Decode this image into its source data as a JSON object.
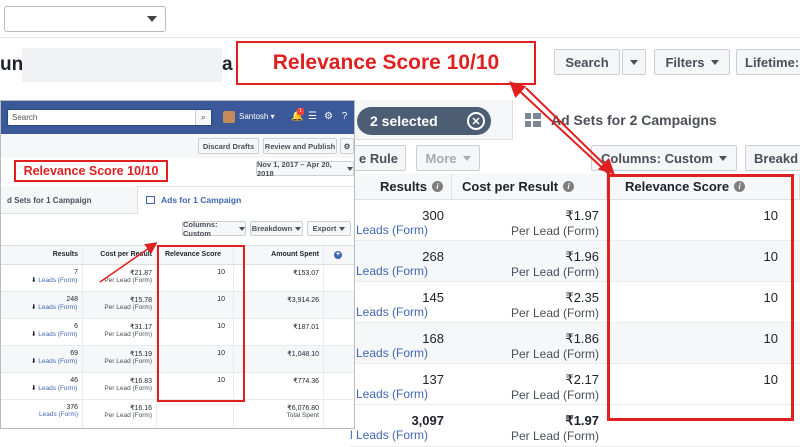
{
  "annotation": {
    "big_callout": "Relevance Score 10/10",
    "inset_callout": "Relevance Score 10/10",
    "color": "#e02020"
  },
  "background": {
    "account_prefix": "unt",
    "account_suffix": "a",
    "toolbar": {
      "search": "Search",
      "filters": "Filters",
      "lifetime": "Lifetime:"
    },
    "selection_pill": "2 selected",
    "adsets_tab": "Ad Sets for 2 Campaigns",
    "rule_button": "e Rule",
    "more_button": "More",
    "columns_button": "Columns: Custom",
    "breakdown_button": "Breakd",
    "table": {
      "headers": [
        "Results",
        "Cost per Result",
        "Relevance Score"
      ],
      "rows": [
        {
          "results": "300",
          "results_sub": "l Leads (Form)",
          "cost": "₹1.97",
          "cost_sub": "Per Lead (Form)",
          "score": "10"
        },
        {
          "results": "268",
          "results_sub": "l Leads (Form)",
          "cost": "₹1.96",
          "cost_sub": "Per Lead (Form)",
          "score": "10"
        },
        {
          "results": "145",
          "results_sub": "l Leads (Form)",
          "cost": "₹2.35",
          "cost_sub": "Per Lead (Form)",
          "score": "10"
        },
        {
          "results": "168",
          "results_sub": "l Leads (Form)",
          "cost": "₹1.86",
          "cost_sub": "Per Lead (Form)",
          "score": "10"
        },
        {
          "results": "137",
          "results_sub": "l Leads (Form)",
          "cost": "₹2.17",
          "cost_sub": "Per Lead (Form)",
          "score": "10"
        }
      ],
      "total": {
        "results": "3,097",
        "results_sub": "l Leads (Form)",
        "cost": "₹1.97",
        "cost_sub": "Per Lead (Form)"
      }
    }
  },
  "inset": {
    "search_placeholder": "Search",
    "user_name": "Santosh",
    "notification_count": "1",
    "discard_drafts": "Discard Drafts",
    "review_publish": "Review and Publish",
    "date_range": "Nov 1, 2017 – Apr 20, 2018",
    "tab_adsets": "d Sets for 1 Campaign",
    "tab_ads": "Ads for 1 Campaign",
    "columns_button": "Columns: Custom",
    "breakdown_button": "Breakdown",
    "export_button": "Export",
    "table": {
      "headers": [
        "Results",
        "Cost per Result",
        "Relevance Score",
        "Amount Spent"
      ],
      "rows": [
        {
          "results": "7",
          "results_sub": "Leads (Form)",
          "cost": "₹21.87",
          "cost_sub": "Per Lead (Form)",
          "score": "10",
          "spent": "₹153.07"
        },
        {
          "results": "248",
          "results_sub": "Leads (Form)",
          "cost": "₹15.78",
          "cost_sub": "Per Lead (Form)",
          "score": "10",
          "spent": "₹3,914.26"
        },
        {
          "results": "6",
          "results_sub": "Leads (Form)",
          "cost": "₹31.17",
          "cost_sub": "Per Lead (Form)",
          "score": "10",
          "spent": "₹187.01"
        },
        {
          "results": "69",
          "results_sub": "Leads (Form)",
          "cost": "₹15.19",
          "cost_sub": "Per Lead (Form)",
          "score": "10",
          "spent": "₹1,048.10"
        },
        {
          "results": "46",
          "results_sub": "Leads (Form)",
          "cost": "₹16.83",
          "cost_sub": "Per Lead (Form)",
          "score": "10",
          "spent": "₹774.36"
        }
      ],
      "total": {
        "results": "376",
        "results_sub": "Leads (Form)",
        "cost": "₹16.16",
        "cost_sub": "Per Lead (Form)",
        "spent": "₹6,076.80",
        "spent_sub": "Total Spent"
      }
    }
  }
}
